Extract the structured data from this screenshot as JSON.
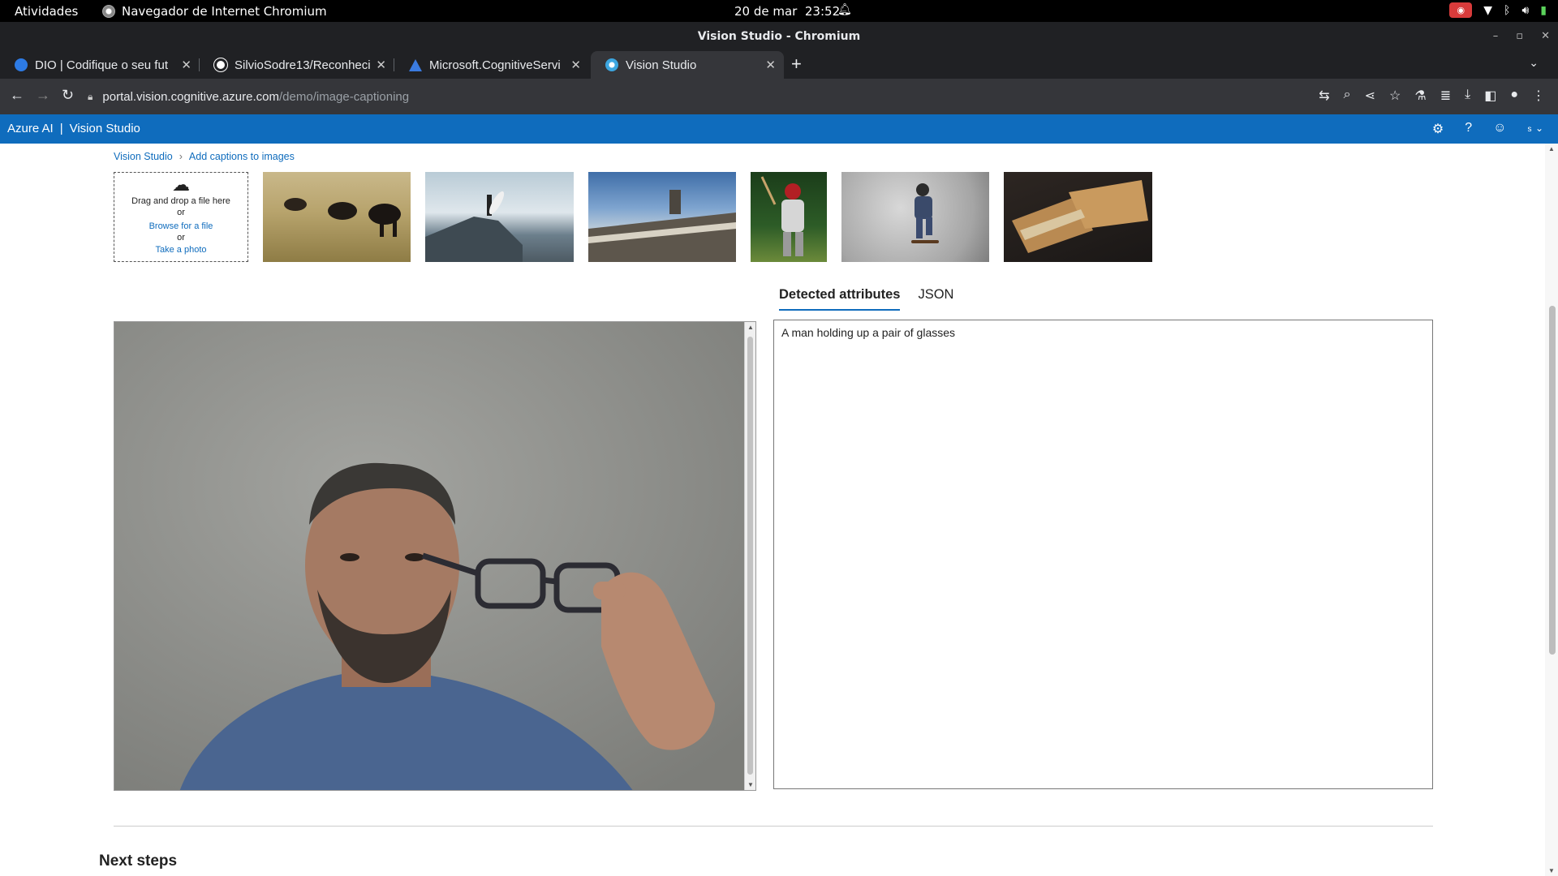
{
  "os": {
    "activities": "Atividades",
    "app_name": "Navegador de Internet Chromium",
    "date": "20 de mar",
    "time": "23:52"
  },
  "window": {
    "title": "Vision Studio - Chromium"
  },
  "tabs": [
    {
      "title": "DIO | Codifique o seu fut",
      "favicon_color": "#2d7be5"
    },
    {
      "title": "SilvioSodre13/Reconheci",
      "favicon_color": "#ffffff"
    },
    {
      "title": "Microsoft.CognitiveServi",
      "favicon_color": "#3a7be0"
    },
    {
      "title": "Vision Studio",
      "favicon_color": "#3ca6e0"
    }
  ],
  "address": {
    "host": "portal.vision.cognitive.azure.com",
    "path": "/demo/image-captioning"
  },
  "azure": {
    "brand": "Azure AI",
    "product": "Vision Studio",
    "account_initial": "s"
  },
  "breadcrumb": {
    "root": "Vision Studio",
    "current": "Add captions to images"
  },
  "upload": {
    "drag_text": "Drag and drop a file here",
    "or1": "or",
    "browse": "Browse for a file",
    "or2": "or",
    "photo": "Take a photo"
  },
  "samples": [
    {
      "name": "sample-cows"
    },
    {
      "name": "sample-surfer"
    },
    {
      "name": "sample-building"
    },
    {
      "name": "sample-baseball"
    },
    {
      "name": "sample-skateboarder"
    },
    {
      "name": "sample-sandwich"
    }
  ],
  "result_tabs": {
    "detected": "Detected attributes",
    "json": "JSON"
  },
  "caption": "A man holding up a pair of glasses",
  "next_steps": "Next steps",
  "colors": {
    "azure_blue": "#0f6cbd",
    "chrome_dark": "#202124",
    "chrome_toolbar": "#35363a"
  }
}
